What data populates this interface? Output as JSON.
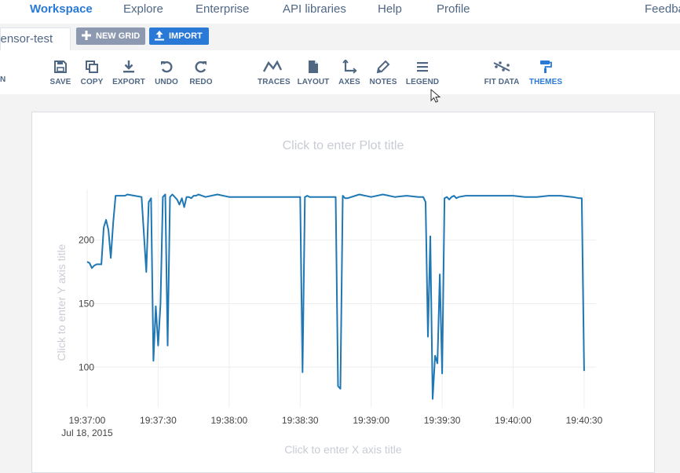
{
  "nav": {
    "items": [
      "Workspace",
      "Explore",
      "Enterprise",
      "API libraries",
      "Help",
      "Profile",
      "Feedback"
    ],
    "active": "Workspace"
  },
  "tabs": {
    "file_tab_label": "sensor-test",
    "new_grid_label": "NEW GRID",
    "import_label": "IMPORT"
  },
  "toolbar": {
    "edge_label": "N",
    "save": "SAVE",
    "copy": "COPY",
    "export": "EXPORT",
    "undo": "UNDO",
    "redo": "REDO",
    "traces": "TRACES",
    "layout": "LAYOUT",
    "axes": "AXES",
    "notes": "NOTES",
    "legend": "LEGEND",
    "fit_data": "FIT DATA",
    "themes": "THEMES"
  },
  "colors": {
    "accent": "#2a79d6",
    "trace": "#1f77b4",
    "muted_button": "#8c99b0"
  },
  "plot": {
    "title_placeholder": "Click to enter Plot title",
    "x_title_placeholder": "Click to enter X axis title",
    "y_title_placeholder": "Click to enter Y axis title"
  },
  "chart_data": {
    "type": "line",
    "title": "",
    "xlabel": "",
    "ylabel": "",
    "date_label": "Jul 18, 2015",
    "x_tick_labels": [
      "19:37:00",
      "19:37:30",
      "19:38:00",
      "19:38:30",
      "19:39:00",
      "19:39:30",
      "19:40:00",
      "19:40:30"
    ],
    "y_ticks": [
      100,
      150,
      200
    ],
    "xlim": [
      "19:37:00",
      "19:40:35"
    ],
    "ylim": [
      68,
      240
    ],
    "grid": true,
    "series": [
      {
        "x": [
          "19:37:00",
          "19:37:01",
          "19:37:02",
          "19:37:03",
          "19:37:04",
          "19:37:06",
          "19:37:07",
          "19:37:08",
          "19:37:09",
          "19:37:10",
          "19:37:11",
          "19:37:12",
          "19:37:13",
          "19:37:14",
          "19:37:15",
          "19:37:16",
          "19:37:17",
          "19:37:20",
          "19:37:23",
          "19:37:25",
          "19:37:26",
          "19:37:27",
          "19:37:28",
          "19:37:29",
          "19:37:30",
          "19:37:31",
          "19:37:32",
          "19:37:33",
          "19:37:34",
          "19:37:35",
          "19:37:36",
          "19:37:37",
          "19:37:38",
          "19:37:39",
          "19:37:40",
          "19:37:41",
          "19:37:42",
          "19:37:43",
          "19:37:44",
          "19:37:45",
          "19:37:46",
          "19:37:47",
          "19:37:50",
          "19:37:55",
          "19:38:00",
          "19:38:05",
          "19:38:10",
          "19:38:15",
          "19:38:20",
          "19:38:25",
          "19:38:30",
          "19:38:31",
          "19:38:32",
          "19:38:33",
          "19:38:34",
          "19:38:40",
          "19:38:45",
          "19:38:46",
          "19:38:47",
          "19:38:48",
          "19:38:49",
          "19:38:50",
          "19:38:55",
          "19:39:00",
          "19:39:05",
          "19:39:10",
          "19:39:15",
          "19:39:20",
          "19:39:22",
          "19:39:23",
          "19:39:24",
          "19:39:25",
          "19:39:26",
          "19:39:27",
          "19:39:28",
          "19:39:29",
          "19:39:30",
          "19:39:31",
          "19:39:32",
          "19:39:33",
          "19:39:34",
          "19:39:35",
          "19:39:36",
          "19:39:37",
          "19:39:40",
          "19:39:45",
          "19:39:50",
          "19:40:00",
          "19:40:05",
          "19:40:10",
          "19:40:15",
          "19:40:20",
          "19:40:25",
          "19:40:28",
          "19:40:29",
          "19:40:30"
        ],
        "values": [
          183,
          182,
          178,
          180,
          181,
          181,
          210,
          216,
          208,
          186,
          214,
          235,
          235,
          235,
          235,
          235,
          236,
          235,
          234,
          175,
          230,
          233,
          105,
          148,
          117,
          150,
          234,
          236,
          117,
          234,
          236,
          234,
          232,
          228,
          233,
          226,
          234,
          234,
          233,
          235,
          235,
          236,
          234,
          236,
          234,
          234,
          234,
          234,
          234,
          234,
          234,
          96,
          234,
          235,
          234,
          234,
          234,
          85,
          83,
          235,
          233,
          233,
          236,
          234,
          236,
          234,
          235,
          234,
          234,
          230,
          124,
          203,
          75,
          109,
          103,
          173,
          95,
          233,
          234,
          232,
          234,
          235,
          233,
          234,
          235,
          235,
          235,
          235,
          234,
          234,
          235,
          235,
          234,
          233,
          233,
          97
        ]
      }
    ]
  }
}
